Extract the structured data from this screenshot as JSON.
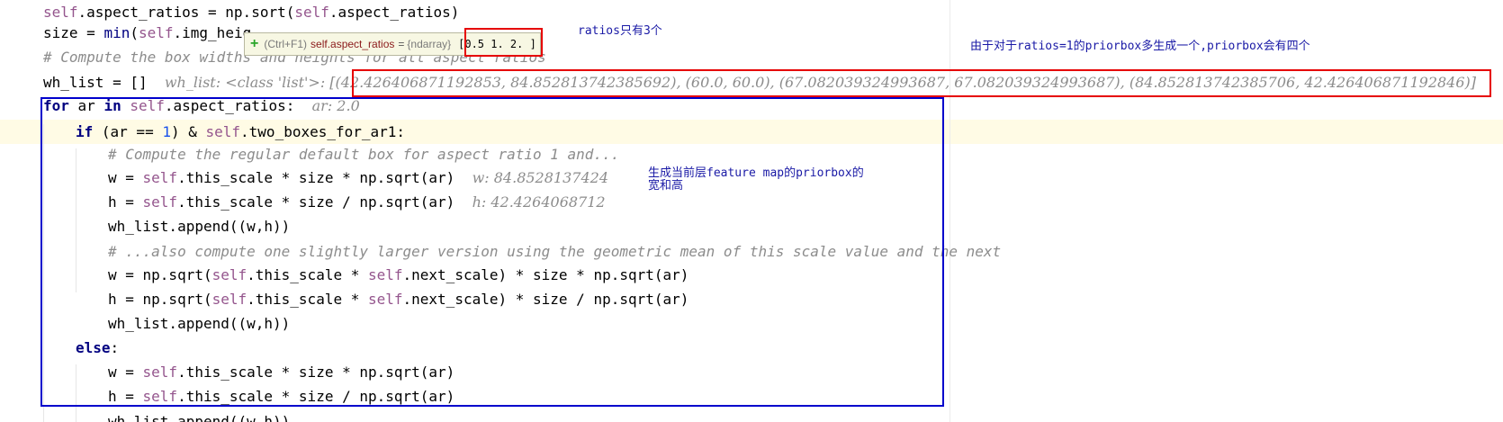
{
  "code_lines": {
    "l1": {
      "a": "self",
      "b": ".aspect_ratios = np.sort(",
      "c": "self",
      "d": ".aspect_ratios)"
    },
    "l2": {
      "a": "size = ",
      "b": "min",
      "c": "(",
      "d": "self",
      "e": ".img_heig"
    },
    "l3": {
      "text": "# Compute the box widths and heights for all aspect ratios"
    },
    "l4": {
      "code": "wh_list = []",
      "inline": "wh_list: <class 'list'>: [(42.426406871192853, 84.852813742385692), (60.0, 60.0), (67.082039324993687, 67.082039324993687), (84.852813742385706, 42.426406871192846)]"
    },
    "l5": {
      "kw1": "for",
      "a": " ar ",
      "kw2": "in",
      "b": " ",
      "self": "self",
      "c": ".aspect_ratios:",
      "inline": "ar: 2.0"
    },
    "l6": {
      "kw": "if",
      "a": " (ar == ",
      "num": "1",
      "b": ") & ",
      "self": "self",
      "c": ".two_boxes_for_ar1:"
    },
    "l7": {
      "text": "# Compute the regular default box for aspect ratio 1 and..."
    },
    "l8": {
      "a": "w = ",
      "self": "self",
      "b": ".this_scale * size * np.sqrt(ar)",
      "inline": "w: 84.8528137424"
    },
    "l9": {
      "a": "h = ",
      "self": "self",
      "b": ".this_scale * size / np.sqrt(ar)",
      "inline": "h: 42.4264068712"
    },
    "l10": {
      "text": "wh_list.append((w,h))"
    },
    "l11": {
      "text": "# ...also compute one slightly larger version using the geometric mean of this scale value and the next"
    },
    "l12": {
      "a": "w = np.sqrt(",
      "self1": "self",
      "b": ".this_scale * ",
      "self2": "self",
      "c": ".next_scale) * size * np.sqrt(ar)"
    },
    "l13": {
      "a": "h = np.sqrt(",
      "self1": "self",
      "b": ".this_scale * ",
      "self2": "self",
      "c": ".next_scale) * size / np.sqrt(ar)"
    },
    "l14": {
      "text": "wh_list.append((w,h))"
    },
    "l15": {
      "kw": "else",
      "rest": ":"
    },
    "l16": {
      "a": "w = ",
      "self": "self",
      "b": ".this_scale * size * np.sqrt(ar)"
    },
    "l17": {
      "a": "h = ",
      "self": "self",
      "b": ".this_scale * size / np.sqrt(ar)"
    },
    "l18": {
      "text": "wh_list.append((w,h))"
    }
  },
  "tooltip": {
    "plus": "+",
    "hint": "(Ctrl+F1)",
    "name": "self.aspect_ratios",
    "eq": "=",
    "type": "{ndarray}",
    "value": "[0.5  1.   2. ]"
  },
  "annotations": {
    "ratios_note": "ratios只有3个",
    "ar1_note": "由于对于ratios=1的priorbox多生成一个,priorbox会有四个",
    "wh_note_1": "生成当前层feature map的priorbox的",
    "wh_note_2": "宽和高"
  },
  "colors": {
    "keyword": "#000080",
    "self": "#94558d",
    "number": "#1750eb",
    "comment": "#8c8c8c",
    "annotation_red": "#e60000",
    "annotation_blue": "#0000cc",
    "annotation_text": "#1a1aa6",
    "current_line": "#fffbe5"
  }
}
